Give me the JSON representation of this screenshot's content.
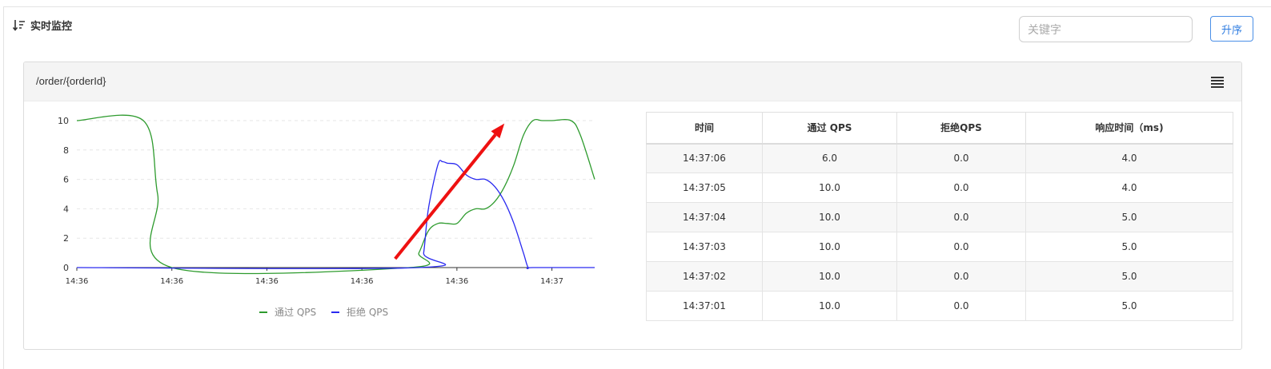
{
  "header": {
    "title": "实时监控",
    "icon": "sort-desc-icon"
  },
  "search": {
    "placeholder": "关键字",
    "value": ""
  },
  "sort_button": {
    "label": "升序"
  },
  "resource": {
    "name": "/order/{orderId}",
    "menu_icon": "menu-icon"
  },
  "table": {
    "columns": [
      "时间",
      "通过 QPS",
      "拒绝QPS",
      "响应时间（ms)"
    ],
    "rows": [
      [
        "14:37:06",
        "6.0",
        "0.0",
        "4.0"
      ],
      [
        "14:37:05",
        "10.0",
        "0.0",
        "4.0"
      ],
      [
        "14:37:04",
        "10.0",
        "0.0",
        "5.0"
      ],
      [
        "14:37:03",
        "10.0",
        "0.0",
        "5.0"
      ],
      [
        "14:37:02",
        "10.0",
        "0.0",
        "5.0"
      ],
      [
        "14:37:01",
        "10.0",
        "0.0",
        "5.0"
      ]
    ]
  },
  "colors": {
    "pass": "#2e9b2e",
    "block": "#2a2af0",
    "annotation": "#ee1111",
    "button": "#2f7de1"
  },
  "chart_data": {
    "type": "line",
    "xlabel": "",
    "ylabel": "",
    "ylim": [
      0,
      10
    ],
    "yticks": [
      0,
      2,
      4,
      6,
      8,
      10
    ],
    "x_tick_labels": [
      "14:36",
      "14:36",
      "14:36",
      "14:36",
      "14:36",
      "14:37"
    ],
    "x_tick_positions": [
      0,
      20,
      40,
      60,
      80,
      100
    ],
    "xlim": [
      0,
      109
    ],
    "grid": true,
    "legend_position": "bottom",
    "series": [
      {
        "name": "通过 QPS",
        "x": [
          0,
          14,
          17,
          20,
          70,
          72,
          74,
          76,
          78,
          80,
          82,
          84,
          86,
          88,
          90,
          92,
          94,
          96,
          98,
          100,
          104,
          106,
          109
        ],
        "values": [
          10,
          10,
          5,
          0,
          0,
          1,
          2.5,
          3,
          3,
          3,
          3.7,
          4,
          4,
          4.5,
          5.5,
          7,
          9,
          10,
          10,
          10,
          10,
          9,
          6
        ]
      },
      {
        "name": "拒绝 QPS",
        "x": [
          0,
          72,
          73,
          74,
          76,
          77,
          78,
          80,
          82,
          84,
          86,
          88,
          90,
          92,
          94,
          95,
          96,
          109
        ],
        "values": [
          0,
          0,
          1,
          4,
          7,
          7.2,
          7.1,
          7,
          6.3,
          6,
          6,
          5.5,
          4.5,
          3,
          1,
          0,
          0,
          0
        ]
      }
    ],
    "annotation": {
      "type": "arrow",
      "from": [
        67,
        0.6
      ],
      "to": [
        90,
        9.8
      ]
    }
  }
}
